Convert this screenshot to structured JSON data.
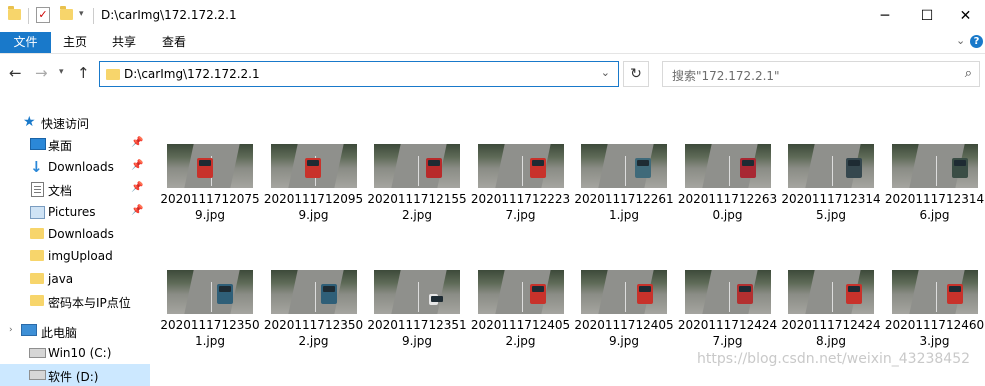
{
  "window": {
    "title": "D:\\carImg\\172.172.2.1",
    "minimize": "─",
    "maximize": "☐",
    "close": "✕"
  },
  "ribbon": {
    "tabs": [
      "文件",
      "主页",
      "共享",
      "查看"
    ]
  },
  "address": {
    "path": "D:\\carImg\\172.172.2.1"
  },
  "search": {
    "placeholder": "搜索\"172.172.2.1\""
  },
  "sidebar": {
    "quick_access": "快速访问",
    "items": [
      {
        "label": "桌面",
        "icon": "desktop-icon",
        "pinned": true
      },
      {
        "label": "Downloads",
        "icon": "download-icon",
        "pinned": true
      },
      {
        "label": "文档",
        "icon": "document-icon",
        "pinned": true
      },
      {
        "label": "Pictures",
        "icon": "pictures-icon",
        "pinned": true
      },
      {
        "label": "Downloads",
        "icon": "folder-icon",
        "pinned": false
      },
      {
        "label": "imgUpload",
        "icon": "folder-icon",
        "pinned": false
      },
      {
        "label": "java",
        "icon": "folder-icon",
        "pinned": false
      },
      {
        "label": "密码本与IP点位",
        "icon": "folder-icon",
        "pinned": false
      }
    ],
    "this_pc": "此电脑",
    "drives": [
      {
        "label": "Win10 (C:)"
      },
      {
        "label": "软件 (D:)"
      }
    ]
  },
  "files": [
    {
      "line1": "2020111712075",
      "line2": "9.jpg",
      "truck_color": "#c8322b"
    },
    {
      "line1": "2020111712095",
      "line2": "9.jpg",
      "truck_color": "#c8322b"
    },
    {
      "line1": "2020111712155",
      "line2": "2.jpg",
      "truck_color": "#b82a2a"
    },
    {
      "line1": "2020111712223",
      "line2": "7.jpg",
      "truck_color": "#c8322b"
    },
    {
      "line1": "2020111712261",
      "line2": "1.jpg",
      "truck_color": "#3f6a7a"
    },
    {
      "line1": "2020111712263",
      "line2": "0.jpg",
      "truck_color": "#a82833"
    },
    {
      "line1": "2020111712314",
      "line2": "5.jpg",
      "truck_color": "#35474e"
    },
    {
      "line1": "2020111712314",
      "line2": "6.jpg",
      "truck_color": "#3a4d45"
    },
    {
      "line1": "2020111712350",
      "line2": "1.jpg",
      "truck_color": "#2f5f78"
    },
    {
      "line1": "2020111712350",
      "line2": "2.jpg",
      "truck_color": "#2f5f78"
    },
    {
      "line1": "2020111712351",
      "line2": "9.jpg",
      "truck_color": "#e6e6e6"
    },
    {
      "line1": "2020111712405",
      "line2": "2.jpg",
      "truck_color": "#c8322b"
    },
    {
      "line1": "2020111712405",
      "line2": "9.jpg",
      "truck_color": "#c8322b"
    },
    {
      "line1": "2020111712424",
      "line2": "7.jpg",
      "truck_color": "#b33030"
    },
    {
      "line1": "2020111712424",
      "line2": "8.jpg",
      "truck_color": "#c8322b"
    },
    {
      "line1": "2020111712460",
      "line2": "3.jpg",
      "truck_color": "#c8322b"
    }
  ],
  "watermark": "https://blog.csdn.net/weixin_43238452",
  "colors": {
    "accent": "#1979ca"
  }
}
